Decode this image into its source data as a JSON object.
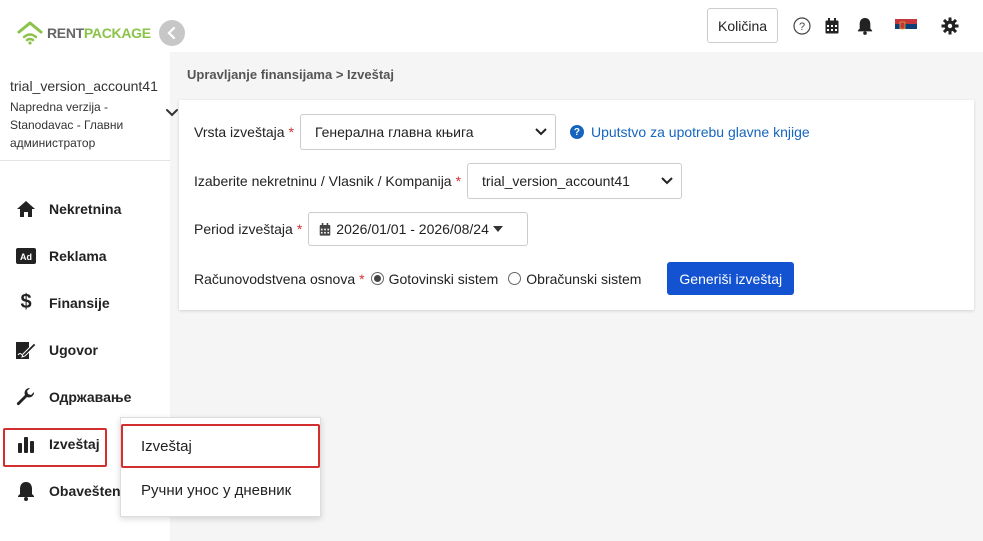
{
  "logo": {
    "part1": "RENT",
    "part2": "PACKAGE"
  },
  "account": {
    "name": "trial_version_account41",
    "role": "Napredna verzija - Stanodavac - Главни администратор"
  },
  "nav": [
    {
      "label": "Nekretnina",
      "icon": "home-icon"
    },
    {
      "label": "Reklama",
      "icon": "ad-icon"
    },
    {
      "label": "Finansije",
      "icon": "dollar-icon"
    },
    {
      "label": "Ugovor",
      "icon": "contract-icon"
    },
    {
      "label": "Одржавање",
      "icon": "wrench-icon"
    },
    {
      "label": "Izveštaj",
      "icon": "bar-chart-icon"
    },
    {
      "label": "Obaveštenj",
      "icon": "bell-icon"
    }
  ],
  "submenu": [
    {
      "label": "Izveštaj"
    },
    {
      "label": "Ручни унос у дневник"
    }
  ],
  "topbar": {
    "quantity_label": "Količina"
  },
  "breadcrumb": "Upravljanje finansijama > Izveštaj",
  "form": {
    "report_type_label": "Vrsta izveštaja",
    "report_type_value": "Генерална главна књига",
    "help_link": "Uputstvo za upotrebu glavne knjige",
    "property_label": "Izaberite nekretninu / Vlasnik / Kompanija",
    "property_value": "trial_version_account41",
    "period_label": "Period izveštaja",
    "period_value": "2026/01/01 - 2026/08/24",
    "basis_label": "Računovodstvena osnova",
    "basis_options": [
      "Gotovinski sistem",
      "Obračunski sistem"
    ],
    "basis_selected": "Gotovinski sistem",
    "generate_label": "Generiši izveštaj",
    "required_mark": "*"
  },
  "colors": {
    "accent": "#1352d1",
    "brand_green": "#8bc34a",
    "required": "#d32f2f"
  }
}
